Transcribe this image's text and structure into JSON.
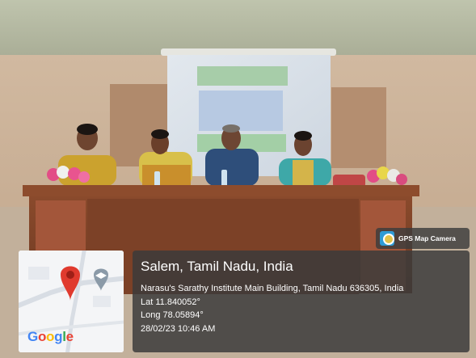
{
  "overlay": {
    "app_badge": {
      "label": "GPS Map Camera",
      "icon": "gps-map-camera-icon"
    },
    "map": {
      "brand": "Google",
      "brand_letter_colors": [
        "#4285F4",
        "#EA4335",
        "#FBBC05",
        "#4285F4",
        "#34A853",
        "#EA4335"
      ],
      "pin_color": "#E03A2E",
      "marker_icon": "graduation-cap-icon"
    },
    "location": {
      "title": "Salem, Tamil Nadu, India",
      "address": "Narasu's Sarathy Institute Main Building, Tamil Nadu 636305, India",
      "latitude": "Lat 11.840052°",
      "longitude": "Long 78.05894°",
      "datetime": "28/02/23 10:46 AM"
    }
  }
}
